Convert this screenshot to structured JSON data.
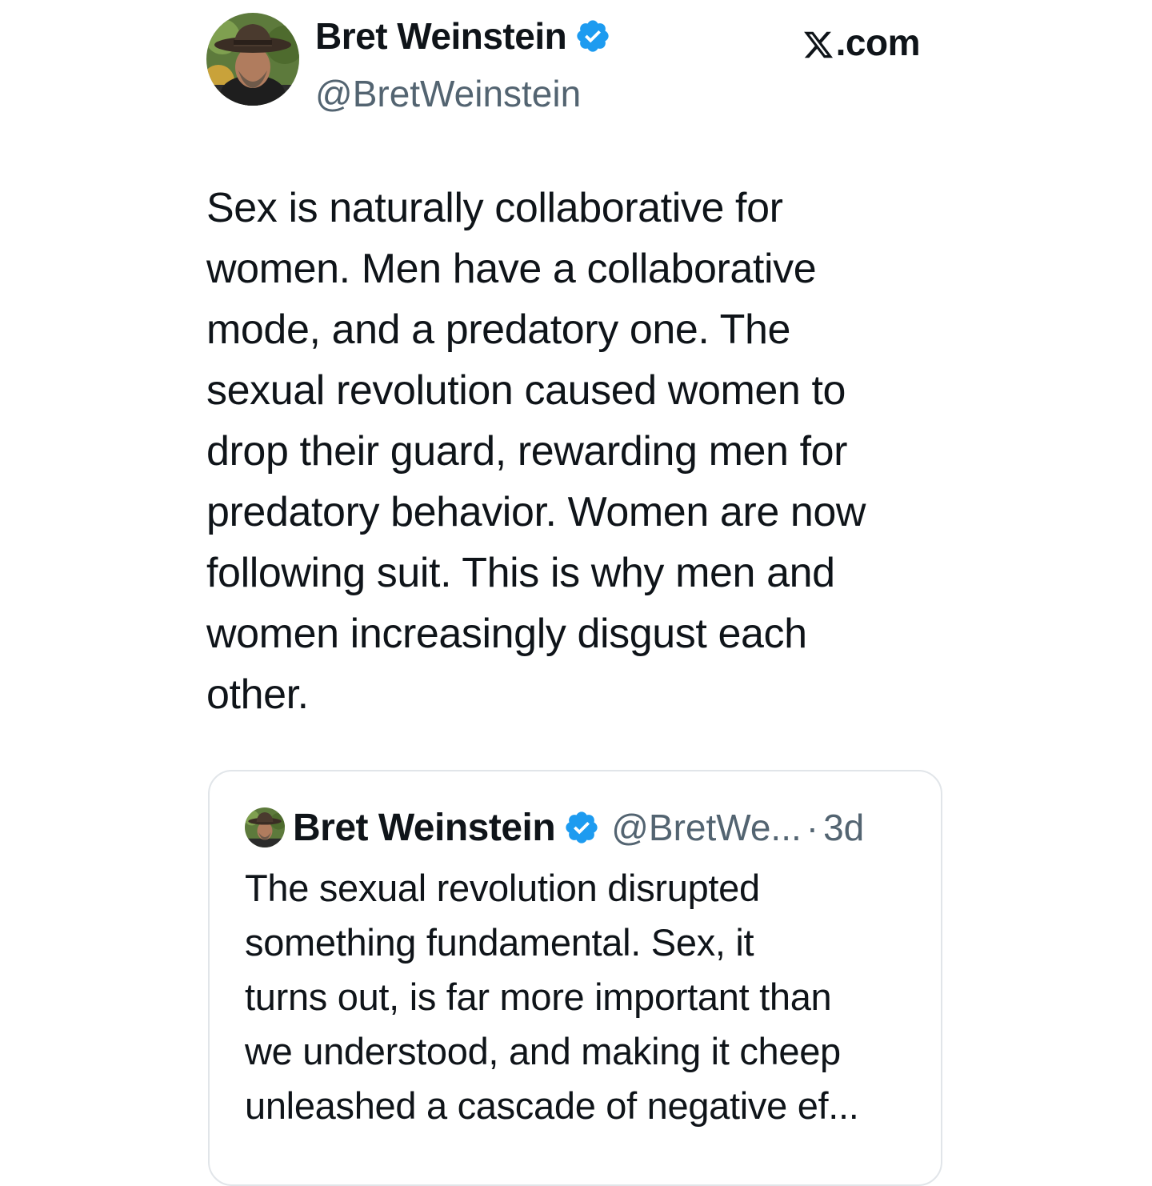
{
  "author": {
    "display_name": "Bret Weinstein",
    "handle": "@BretWeinstein",
    "verified": true,
    "avatar_icon": "profile-photo-man-in-hat"
  },
  "site": {
    "logo_icon": "x-logo-icon",
    "domain_suffix": ".com"
  },
  "tweet": {
    "text": "Sex is naturally collaborative for\nwomen. Men have a collaborative\nmode, and a predatory one. The\nsexual revolution caused women to\ndrop their guard, rewarding men for\npredatory behavior. Women are now\nfollowing suit. This is why men and\nwomen increasingly disgust each\nother."
  },
  "quoted_tweet": {
    "display_name": "Bret Weinstein",
    "handle": "@BretWe...",
    "separator": "·",
    "time": "3d",
    "text": "The sexual revolution disrupted\nsomething fundamental. Sex, it\nturns out, is far more important than\nwe understood, and making it cheep\nunleashed a cascade of negative ef..."
  },
  "colors": {
    "text": "#0f1419",
    "secondary": "#536471",
    "verified_badge": "#1d9bf0",
    "card_border": "#e1e5e9"
  }
}
